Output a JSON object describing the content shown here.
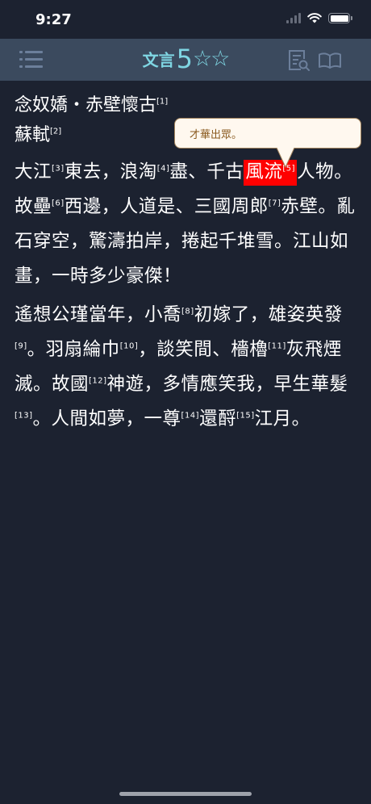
{
  "status_bar": {
    "time": "9:27"
  },
  "nav": {
    "title": "文言",
    "level": "5",
    "stars": "☆☆",
    "icons": [
      "menu-icon",
      "search-document-icon",
      "book-icon"
    ]
  },
  "poem": {
    "title": "念奴嬌・赤壁懷古",
    "title_ref": "[1]",
    "author": "蘇軾",
    "author_ref": "[2]"
  },
  "stanza1": {
    "s1": "大江",
    "r3": "[3]",
    "s2": "東去，浪淘",
    "r4": "[4]",
    "s3": "盡、千古",
    "hl": "風流",
    "r5": "[5]",
    "s4": "人物。故壘",
    "r6": "[6]",
    "s5": "西邊，人道是、三國周郎",
    "r7": "[7]",
    "s6": "赤壁。亂石穿空，驚濤拍岸，捲起千堆雪。江山如畫，一時多少豪傑！"
  },
  "stanza2": {
    "s1": "遙想公瑾當年，小喬",
    "r8": "[8]",
    "s2": "初嫁了，雄姿英發",
    "r9": "[9]",
    "s3": "。羽扇綸巾",
    "r10": "[10]",
    "s4": "，談笑間、檣櫓",
    "r11": "[11]",
    "s5": "灰飛煙滅。故國",
    "r12": "[12]",
    "s6": "神遊，多情應笑我，早生華髮",
    "r13": "[13]",
    "s7": "。人間如夢，一尊",
    "r14": "[14]",
    "s8": "還酹",
    "r15": "[15]",
    "s9": "江月。"
  },
  "tooltip": {
    "text": "才華出眾。"
  },
  "colors": {
    "background": "#1c2230",
    "nav_background": "#3b4a5e",
    "accent": "#7fd6e3",
    "highlight": "#ff0000",
    "tooltip_bg": "#fff8ef",
    "tooltip_text": "#8a5a1f"
  }
}
